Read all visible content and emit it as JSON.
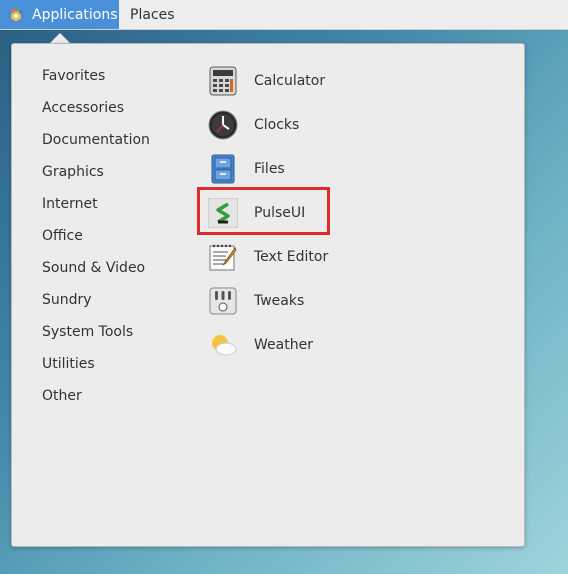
{
  "topbar": {
    "applications_label": "Applications",
    "places_label": "Places"
  },
  "categories": [
    {
      "label": "Favorites"
    },
    {
      "label": "Accessories"
    },
    {
      "label": "Documentation"
    },
    {
      "label": "Graphics"
    },
    {
      "label": "Internet"
    },
    {
      "label": "Office"
    },
    {
      "label": "Sound & Video"
    },
    {
      "label": "Sundry"
    },
    {
      "label": "System Tools"
    },
    {
      "label": "Utilities"
    },
    {
      "label": "Other"
    }
  ],
  "apps": [
    {
      "label": "Calculator",
      "icon": "calculator-icon"
    },
    {
      "label": "Clocks",
      "icon": "clock-icon"
    },
    {
      "label": "Files",
      "icon": "file-cabinet-icon"
    },
    {
      "label": "PulseUI",
      "icon": "pulse-icon"
    },
    {
      "label": "Text Editor",
      "icon": "text-editor-icon"
    },
    {
      "label": "Tweaks",
      "icon": "tweaks-icon"
    },
    {
      "label": "Weather",
      "icon": "weather-icon"
    }
  ],
  "highlight": {
    "target": "PulseUI",
    "color": "#e02b2b"
  },
  "colors": {
    "accent": "#4a90d9"
  }
}
